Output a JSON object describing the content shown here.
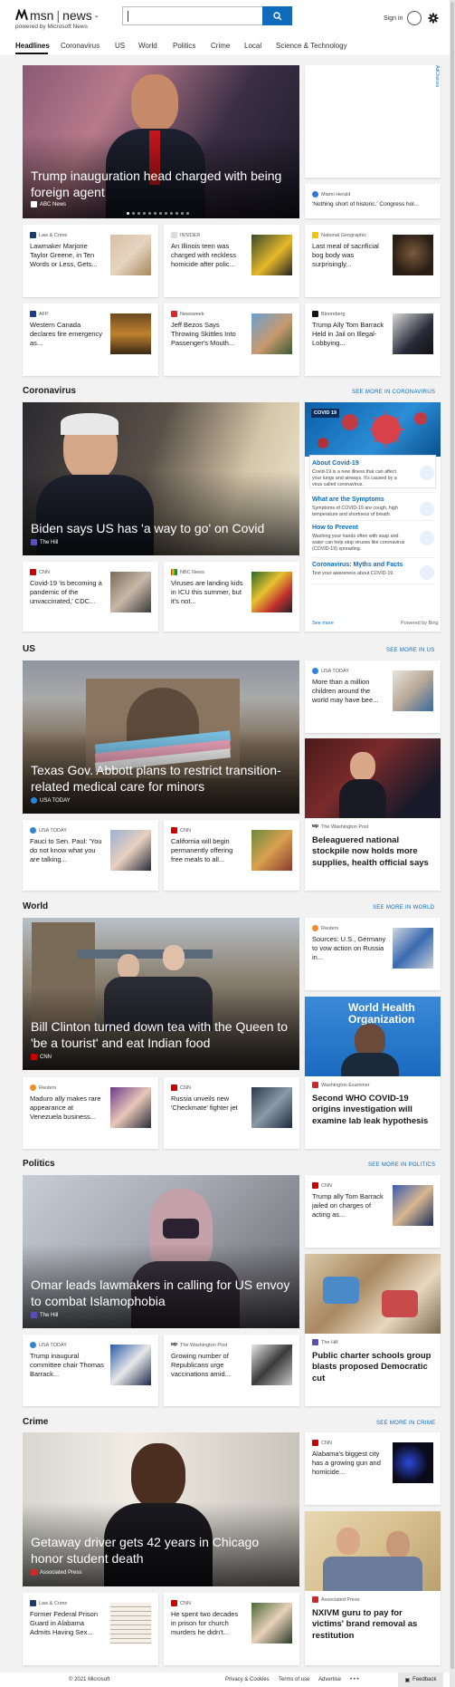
{
  "header": {
    "logo_text": "msn",
    "section_text": "news",
    "powered_by": "powered by Microsoft News",
    "search_placeholder": "",
    "sign_in": "Sign in"
  },
  "nav": {
    "tabs": [
      {
        "label": "Headlines"
      },
      {
        "label": "Coronavirus"
      },
      {
        "label": "US"
      },
      {
        "label": "World"
      },
      {
        "label": "Politics"
      },
      {
        "label": "Crime"
      },
      {
        "label": "Local"
      },
      {
        "label": "Science & Technology"
      }
    ]
  },
  "ad_choices": "AdChoices",
  "headlines": {
    "hero": {
      "title": "Trump inauguration head charged with being foreign agent",
      "source": "ABC News"
    },
    "side": {
      "source": "Miami Herald",
      "title": "'Nothing short of historic.' Congress hol..."
    },
    "cards": [
      {
        "source": "Law & Crime",
        "title": "Lawmaker Marjorie Taylor Greene, in Ten Words or Less, Gets..."
      },
      {
        "source": "INSIDER",
        "title": "An Illinois teen was charged with reckless homicide after polic..."
      },
      {
        "source": "National Geographic",
        "title": "Last meal of sacrificial bog body was surprisingly..."
      },
      {
        "source": "AFP",
        "title": "Western Canada declares fire emergency as..."
      },
      {
        "source": "Newsweek",
        "title": "Jeff Bezos Says Throwing Skittles Into Passenger's Mouth..."
      },
      {
        "source": "Bloomberg",
        "title": "Trump Ally Tom Barrack Held in Jail on Illegal-Lobbying..."
      }
    ]
  },
  "coronavirus": {
    "title": "Coronavirus",
    "see_more": "SEE MORE IN CORONAVIRUS",
    "hero": {
      "title": "Biden says US has 'a way to go' on Covid",
      "source": "The Hill"
    },
    "cards": [
      {
        "source": "CNN",
        "title": "Covid-19 'is becoming a pandemic of the unvaccinated,' CDC..."
      },
      {
        "source": "NBC News",
        "title": "Viruses are landing kids in ICU this summer, but it's not..."
      }
    ],
    "panel": {
      "tag": "COVID 19",
      "items": [
        {
          "heading": "About Covid-19",
          "text": "Covid-19 is a new illness that can affect your lungs and airways. It's caused by a virus called coronavirus."
        },
        {
          "heading": "What are the Symptoms",
          "text": "Symptoms of COVID-19 are cough, high temperature and shortness of breath."
        },
        {
          "heading": "How to Prevent",
          "text": "Washing your hands often with soap and water can help stop viruses like coronavirus (COVID-19) spreading."
        },
        {
          "heading": "Coronavirus: Myths and Facts",
          "text": "Test your awareness about COVID-19."
        }
      ],
      "see_more": "See more",
      "powered": "Powered by Bing"
    }
  },
  "us": {
    "title": "US",
    "see_more": "SEE MORE IN US",
    "hero": {
      "title": "Texas Gov. Abbott plans to restrict transition-related medical care for minors",
      "source": "USA TODAY"
    },
    "side": {
      "source": "USA TODAY",
      "title": "More than a million children around the world may have bee..."
    },
    "big": {
      "source": "The Washington Post",
      "title": "Beleaguered national stockpile now holds more supplies, health official says"
    },
    "cards": [
      {
        "source": "USA TODAY",
        "title": "Fauci to Sen. Paul: 'You do not know what you are talking..."
      },
      {
        "source": "CNN",
        "title": "California will begin permanently offering free meals to all..."
      }
    ]
  },
  "world": {
    "title": "World",
    "see_more": "SEE MORE IN WORLD",
    "hero": {
      "title": "Bill Clinton turned down tea with the Queen to 'be a tourist' and eat Indian food",
      "source": "CNN"
    },
    "side": {
      "source": "Reuters",
      "title": "Sources: U.S., Germany to vow action on Russia in..."
    },
    "big": {
      "source": "Washington Examiner",
      "title": "Second WHO COVID-19 origins investigation will examine lab leak hypothesis"
    },
    "cards": [
      {
        "source": "Reuters",
        "title": "Maduro ally makes rare appearance at Venezuela business..."
      },
      {
        "source": "CNN",
        "title": "Russia unveils new 'Checkmate' fighter jet"
      }
    ]
  },
  "politics": {
    "title": "Politics",
    "see_more": "SEE MORE IN POLITICS",
    "hero": {
      "title": "Omar leads lawmakers in calling for US envoy to combat Islamophobia",
      "source": "The Hill"
    },
    "side": {
      "source": "CNN",
      "title": "Trump ally Tom Barrack jailed on charges of acting as..."
    },
    "big": {
      "source": "The Hill",
      "title": "Public charter schools group blasts proposed Democratic cut"
    },
    "cards": [
      {
        "source": "USA TODAY",
        "title": "Trump inaugural committee chair Thomas Barrack..."
      },
      {
        "source": "The Washington Post",
        "title": "Growing number of Republicans urge vaccinations amid..."
      }
    ]
  },
  "crime": {
    "title": "Crime",
    "see_more": "SEE MORE IN CRIME",
    "hero": {
      "title": "Getaway driver gets 42 years in Chicago honor student death",
      "source": "Associated Press"
    },
    "side": {
      "source": "CNN",
      "title": "Alabama's biggest city has a growing gun and homicide..."
    },
    "big": {
      "source": "Associated Press",
      "title": "NXIVM guru to pay for victims' brand removal as restitution"
    },
    "cards": [
      {
        "source": "Law & Crime",
        "title": "Former Federal Prison Guard in Alabama Admits Having Sex..."
      },
      {
        "source": "CNN",
        "title": "He spent two decades in prison for church murders he didn't..."
      }
    ]
  },
  "footer": {
    "copyright": "© 2021 Microsoft",
    "privacy": "Privacy & Cookies",
    "terms": "Terms of use",
    "advertise": "Advertise",
    "more": "• • •",
    "feedback": "Feedback"
  },
  "colors": {
    "accent": "#0f6cbd",
    "background": "#f2f2f2"
  }
}
